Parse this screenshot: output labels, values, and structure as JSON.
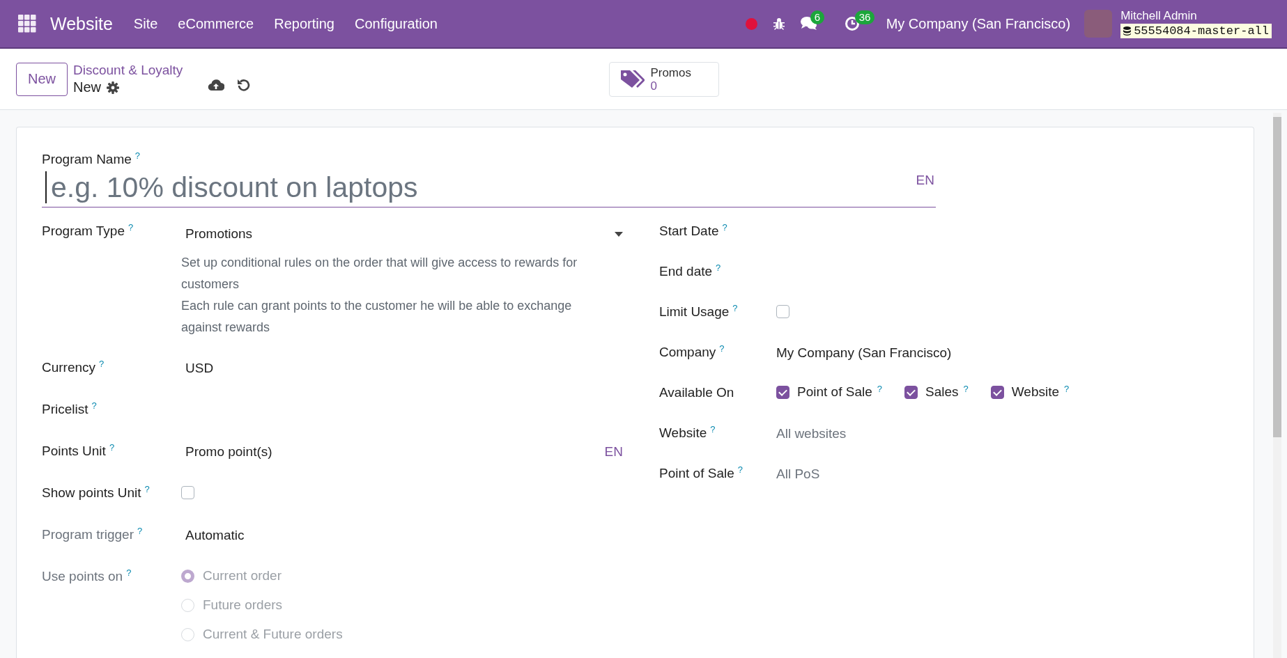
{
  "navbar": {
    "app_name": "Website",
    "menu": [
      "Site",
      "eCommerce",
      "Reporting",
      "Configuration"
    ],
    "chat_count": "6",
    "activity_count": "36",
    "company": "My Company (San Francisco)",
    "user_name": "Mitchell Admin",
    "database": "55554084-master-all"
  },
  "control_panel": {
    "new_button": "New",
    "breadcrumb": "Discount & Loyalty",
    "record": "New",
    "smart_button": {
      "label": "Promos",
      "count": "0"
    }
  },
  "form": {
    "program_name": {
      "label": "Program Name",
      "help": "?",
      "placeholder": "e.g. 10% discount on laptops",
      "lang": "EN"
    },
    "left_fields": [
      {
        "kind": "select",
        "label": "Program Type",
        "help": "?",
        "readonly": false,
        "value": "Promotions",
        "description": [
          "Set up conditional rules on the order that will give access to rewards for customers",
          "Each rule can grant points to the customer he will be able to exchange against rewards"
        ]
      },
      {
        "kind": "text",
        "label": "Currency",
        "help": "?",
        "readonly": false,
        "value": "USD"
      },
      {
        "kind": "empty",
        "label": "Pricelist",
        "help": "?",
        "readonly": false
      },
      {
        "kind": "text",
        "label": "Points Unit",
        "help": "?",
        "readonly": false,
        "value": "Promo point(s)",
        "lang": "EN"
      },
      {
        "kind": "checkbox",
        "label": "Show points Unit",
        "help": "?",
        "readonly": false,
        "checked": false
      },
      {
        "kind": "text",
        "label": "Program trigger",
        "help": "?",
        "readonly": true,
        "value": "Automatic"
      },
      {
        "kind": "radio",
        "label": "Use points on",
        "help": "?",
        "readonly": true,
        "options": [
          {
            "label": "Current order",
            "selected": true
          },
          {
            "label": "Future orders",
            "selected": false
          },
          {
            "label": "Current & Future orders",
            "selected": false
          }
        ]
      }
    ],
    "right_fields": [
      {
        "kind": "empty",
        "label": "Start Date",
        "help": "?",
        "readonly": false
      },
      {
        "kind": "empty",
        "label": "End date",
        "help": "?",
        "readonly": false
      },
      {
        "kind": "checkbox",
        "label": "Limit Usage",
        "help": "?",
        "readonly": false,
        "checked": false
      },
      {
        "kind": "text",
        "label": "Company",
        "help": "?",
        "readonly": false,
        "value": "My Company (San Francisco)"
      },
      {
        "kind": "checks",
        "label": "Available On",
        "readonly": false,
        "options": [
          {
            "label": "Point of Sale",
            "help": "?",
            "checked": true
          },
          {
            "label": "Sales",
            "help": "?",
            "checked": true
          },
          {
            "label": "Website",
            "help": "?",
            "checked": true
          }
        ]
      },
      {
        "kind": "placeholder",
        "label": "Website",
        "help": "?",
        "readonly": false,
        "placeholder": "All websites"
      },
      {
        "kind": "placeholder",
        "label": "Point of Sale",
        "help": "?",
        "readonly": false,
        "placeholder": "All PoS"
      }
    ]
  }
}
